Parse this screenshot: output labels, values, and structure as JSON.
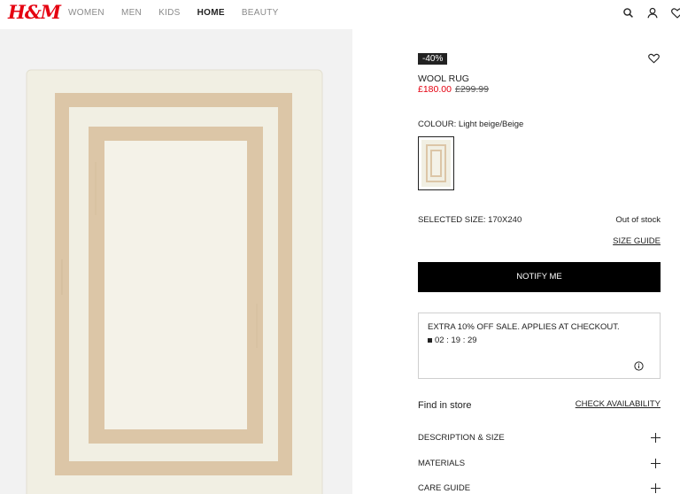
{
  "header": {
    "logo": "H&M",
    "nav": [
      {
        "label": "WOMEN",
        "active": false
      },
      {
        "label": "MEN",
        "active": false
      },
      {
        "label": "KIDS",
        "active": false
      },
      {
        "label": "HOME",
        "active": true
      },
      {
        "label": "BEAUTY",
        "active": false
      }
    ],
    "icons": [
      "search-icon",
      "account-icon",
      "favourites-icon"
    ]
  },
  "product": {
    "image_alt": "Wool rug, light beige with beige border stripes",
    "discount_badge": "-40%",
    "name": "WOOL RUG",
    "price_now": "£180.00",
    "price_old": "£299.99",
    "colour_label": "COLOUR: Light beige/Beige",
    "selected_size": "SELECTED SIZE: 170X240",
    "stock_status": "Out of stock",
    "size_guide": "SIZE GUIDE",
    "notify_button": "NOTIFY ME"
  },
  "promo": {
    "text": "EXTRA 10% OFF SALE. APPLIES AT CHECKOUT.",
    "timer": "02 : 19 : 29"
  },
  "store": {
    "find_in_store": "Find in store",
    "check_availability": "CHECK AVAILABILITY"
  },
  "accordions": [
    {
      "label": "DESCRIPTION & SIZE"
    },
    {
      "label": "MATERIALS"
    },
    {
      "label": "CARE GUIDE"
    }
  ],
  "colors": {
    "brand": "#e50010",
    "rug_cream": "#f1efe3",
    "rug_beige": "#dcc6a7"
  }
}
